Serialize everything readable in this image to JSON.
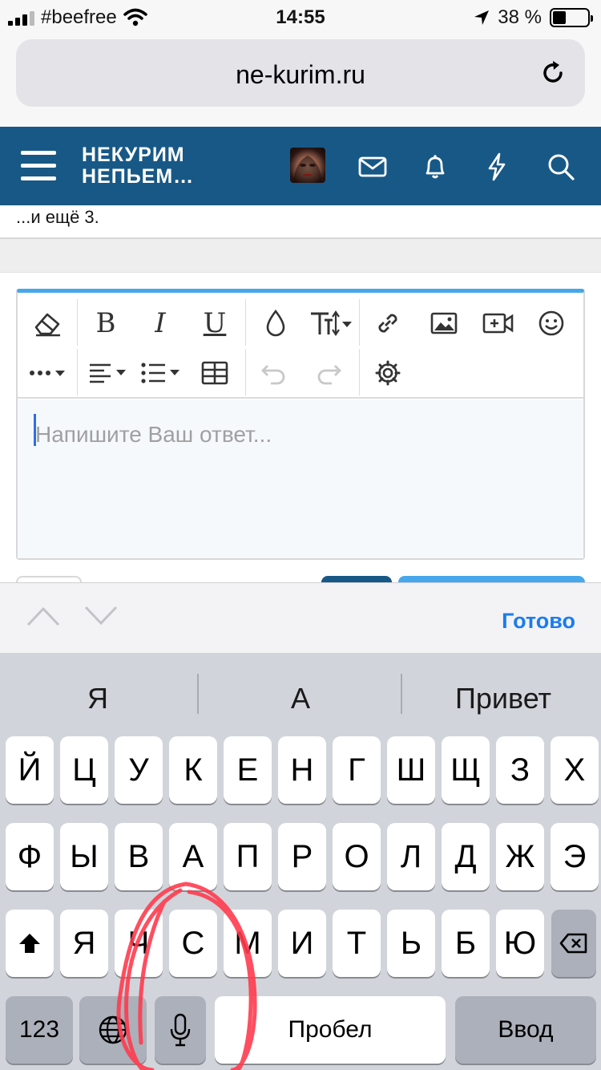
{
  "status_bar": {
    "carrier": "#beefree",
    "time": "14:55",
    "battery_percent": "38 %",
    "battery_level": 0.38
  },
  "browser": {
    "url": "ne-kurim.ru"
  },
  "site_header": {
    "logo_line1": "НЕКУРИМ",
    "logo_line2": "НЕПЬЕМ…",
    "colors": {
      "header_bg": "#185886"
    },
    "icons": [
      "menu-icon",
      "avatar",
      "mail-icon",
      "bell-icon",
      "lightning-icon",
      "search-icon"
    ]
  },
  "content": {
    "more_text": "...и ещё 3."
  },
  "editor": {
    "placeholder": "Напишите Ваш ответ...",
    "accent_color": "#47a7eb",
    "toolbar_icons": [
      "eraser-icon",
      "bold-icon",
      "italic-icon",
      "underline-icon",
      "color-drop-icon",
      "text-size-icon",
      "link-icon",
      "image-icon",
      "video-icon",
      "smiley-icon",
      "more-icon",
      "align-icon",
      "list-icon",
      "table-icon",
      "undo-icon",
      "redo-icon",
      "settings-icon"
    ],
    "bold_label": "B",
    "italic_label": "I",
    "underline_label": "U"
  },
  "accessory": {
    "done_label": "Готово"
  },
  "keyboard": {
    "suggestions": [
      "Я",
      "А",
      "Привет"
    ],
    "row1": [
      "Й",
      "Ц",
      "У",
      "К",
      "Е",
      "Н",
      "Г",
      "Ш",
      "Щ",
      "З",
      "Х"
    ],
    "row2": [
      "Ф",
      "Ы",
      "В",
      "А",
      "П",
      "Р",
      "О",
      "Л",
      "Д",
      "Ж",
      "Э"
    ],
    "row3": [
      "Я",
      "Ч",
      "С",
      "М",
      "И",
      "Т",
      "Ь",
      "Б",
      "Ю"
    ],
    "numbers_key": "123",
    "space_key": "Пробел",
    "return_key": "Ввод"
  }
}
